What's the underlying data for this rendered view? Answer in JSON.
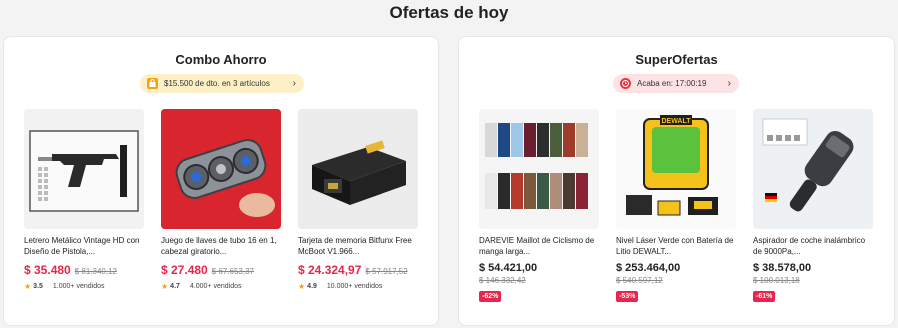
{
  "page": {
    "title": "Ofertas de hoy"
  },
  "combo": {
    "title": "Combo Ahorro",
    "pill_text": "$15.500 de dto. en 3 artículos",
    "products": [
      {
        "name": "Letrero Metálico Vintage HD con Diseño de Pistola,...",
        "price": "$ 35.480",
        "old_price": "$ 81.340,12",
        "rating": "3.5",
        "sold": "1.000+ vendidos"
      },
      {
        "name": "Juego de llaves de tubo 16 en 1, cabezal giratorio...",
        "price": "$ 27.480",
        "old_price": "$ 67.653,37",
        "rating": "4.7",
        "sold": "4.000+ vendidos"
      },
      {
        "name": "Tarjeta de memoria Bitfunx Free McBoot V1.966...",
        "price": "$ 24.324,97",
        "old_price": "$ 57.917,52",
        "rating": "4.9",
        "sold": "10.000+ vendidos"
      }
    ]
  },
  "super": {
    "title": "SuperOfertas",
    "pill_text": "Acaba en: 17:00:19",
    "products": [
      {
        "name": "DAREVIE Maillot de Ciclismo de manga larga...",
        "price": "$ 54.421,00",
        "old_price": "$ 146.332,42",
        "discount": "-62%"
      },
      {
        "name": "Nivel Láser Verde con Batería de Litio DEWALT...",
        "price": "$ 253.464,00",
        "old_price": "$ 540.597,12",
        "discount": "-53%"
      },
      {
        "name": "Aspirador de coche inalámbrico de 9000Pa,...",
        "price": "$ 38.578,00",
        "old_price": "$ 100.013,18",
        "discount": "-61%"
      }
    ]
  },
  "image_text": {
    "level_brand": "DEWALT"
  },
  "colors": {
    "price_red": "#e8264d",
    "star": "#f3a313",
    "pill_yellow": "#fdf0c7",
    "pill_pink": "#fde3e3",
    "badge_red": "#e8264d"
  }
}
